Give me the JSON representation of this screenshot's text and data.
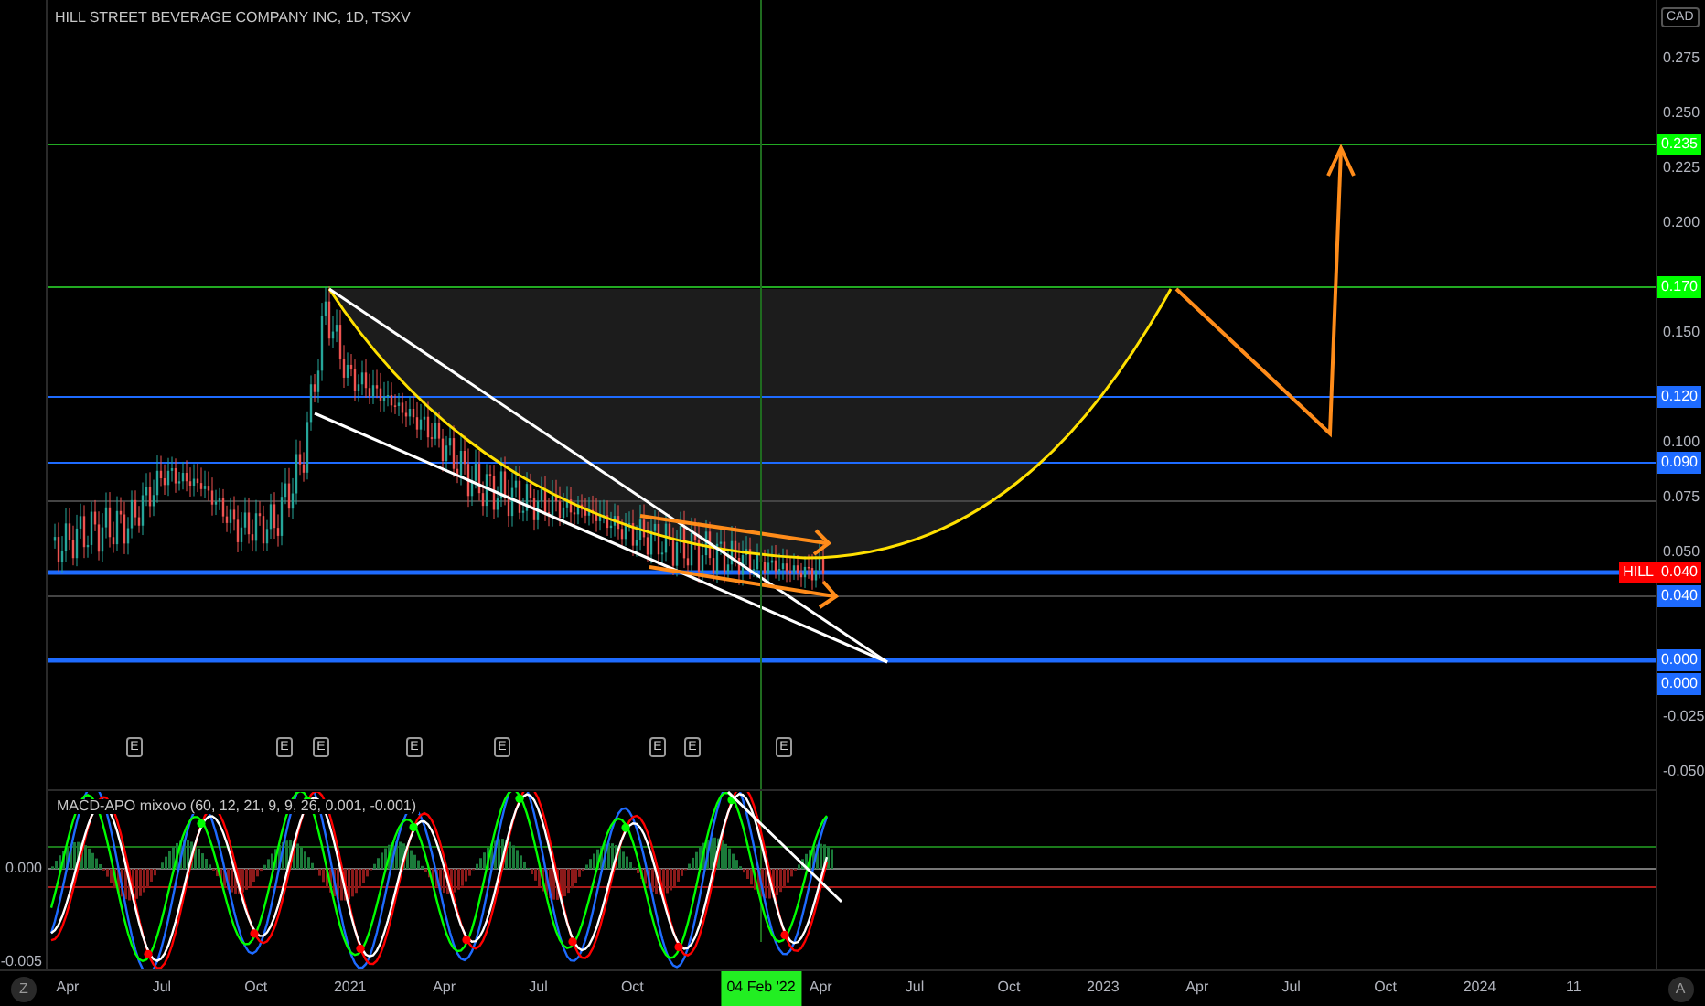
{
  "title": "HILL STREET BEVERAGE COMPANY INC, 1D, TSXV",
  "currency": "CAD",
  "price_axis": [
    "0.275",
    "0.250",
    "0.225",
    "0.200",
    "0.150",
    "0.100",
    "0.075",
    "0.050",
    "-0.025",
    "-0.050"
  ],
  "price_badges": [
    {
      "label": "0.235",
      "color": "#00ff00"
    },
    {
      "label": "0.170",
      "color": "#00ff00"
    },
    {
      "label": "0.120",
      "color": "#1e6bff"
    },
    {
      "label": "0.090",
      "color": "#1e6bff"
    },
    {
      "label": "0.040",
      "color": "#ff0000",
      "symbol": "HILL"
    },
    {
      "label": "0.040",
      "color": "#1e6bff"
    },
    {
      "label": "0.000",
      "color": "#1e6bff"
    },
    {
      "label": "0.000",
      "color": "#1e6bff"
    }
  ],
  "earnings_markers": [
    "E",
    "E",
    "E",
    "E",
    "E",
    "E",
    "E",
    "E"
  ],
  "indicator": {
    "title": "MACD-APO mixovo (60, 12, 21, 9, 9, 26, 0.001, -0.001)",
    "axis": [
      "0.000",
      "-0.005"
    ]
  },
  "time_axis": [
    "Apr",
    "Jul",
    "Oct",
    "2021",
    "Apr",
    "Jul",
    "Oct",
    "Apr",
    "Jul",
    "Oct",
    "2023",
    "Apr",
    "Jul",
    "Oct",
    "2024",
    "11"
  ],
  "crosshair_date": "04 Feb '22",
  "left_corner_button": "Z",
  "right_corner_button": "A"
}
